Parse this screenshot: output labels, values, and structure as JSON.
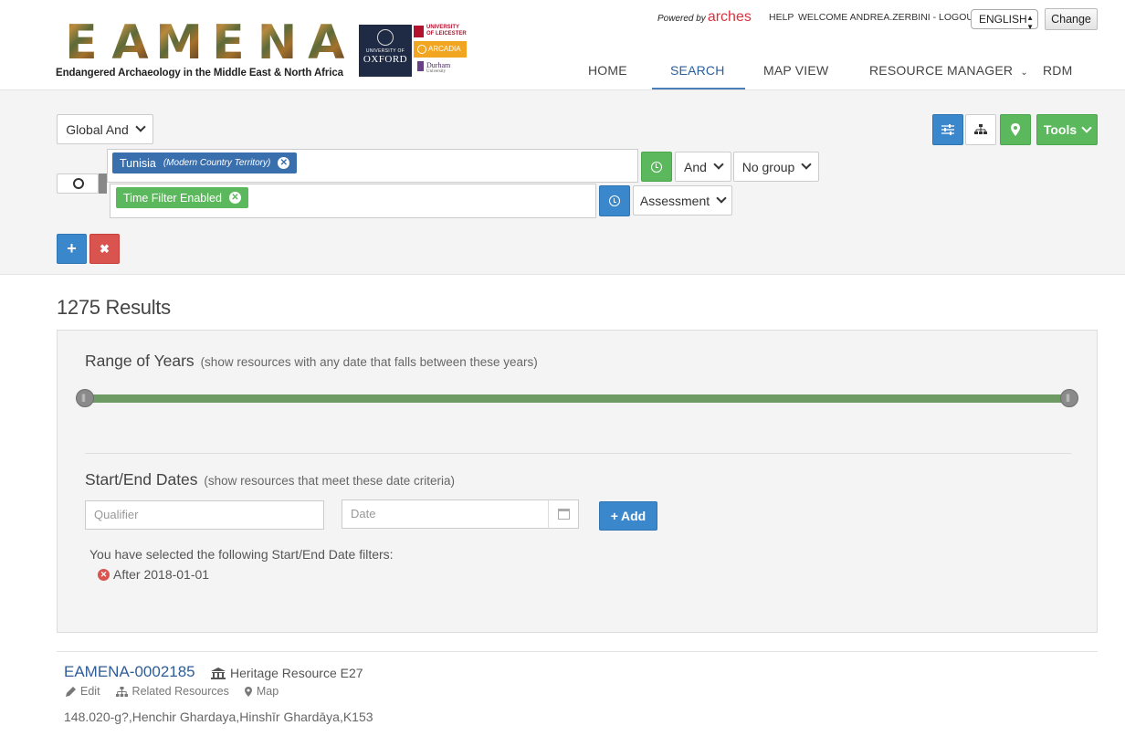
{
  "header": {
    "logo_word": [
      "E",
      "A",
      "M",
      "E",
      "N",
      "A"
    ],
    "logo_subtitle": "Endangered Archaeology in the Middle East & North Africa",
    "partners": {
      "oxford_small": "UNIVERSITY OF",
      "oxford_name": "OXFORD",
      "leicester": "UNIVERSITY OF LEICESTER",
      "arcadia": "ARCADIA",
      "durham": "Durham",
      "durham_small": "University"
    },
    "powered_by": "Powered by",
    "arches": "arches",
    "help": "HELP",
    "welcome": "WELCOME ANDREA.ZERBINI - LOGOUT",
    "language": "ENGLISH",
    "change_button": "Change"
  },
  "nav": {
    "home": "HOME",
    "search": "SEARCH",
    "map_view": "MAP VIEW",
    "resource_manager": "RESOURCE MANAGER",
    "rdm": "RDM"
  },
  "search": {
    "global_operator": "Global And",
    "tools": "Tools",
    "term_1": {
      "label": "Tunisia",
      "context": "(Modern Country Territory)"
    },
    "term_1_operator": "And",
    "term_1_group": "No group",
    "term_2": {
      "label": "Time Filter Enabled"
    },
    "term_2_type": "Assessment"
  },
  "results": {
    "count": "1275 Results"
  },
  "time_filter": {
    "range_title": "Range of Years",
    "range_hint": "(show resources with any date that falls between these years)",
    "dates_title": "Start/End Dates",
    "dates_hint": "(show resources that meet these date criteria)",
    "qualifier_placeholder": "Qualifier",
    "date_placeholder": "Date",
    "add_button": "Add",
    "selected_text": "You have selected the following Start/End Date filters:",
    "selected_filter": "After 2018-01-01"
  },
  "result_item": {
    "id": "EAMENA-0002185",
    "type": "Heritage Resource E27",
    "edit": "Edit",
    "related": "Related Resources",
    "map": "Map",
    "description": "148.020-g?,Henchir Ghardaya,Hinshīr Ghardāya,K153"
  },
  "colors": {
    "primary_blue": "#3a87cc",
    "green": "#5cb85c",
    "red": "#d9534f",
    "slider_green": "#6e9a63",
    "link_blue": "#2f5d97"
  }
}
